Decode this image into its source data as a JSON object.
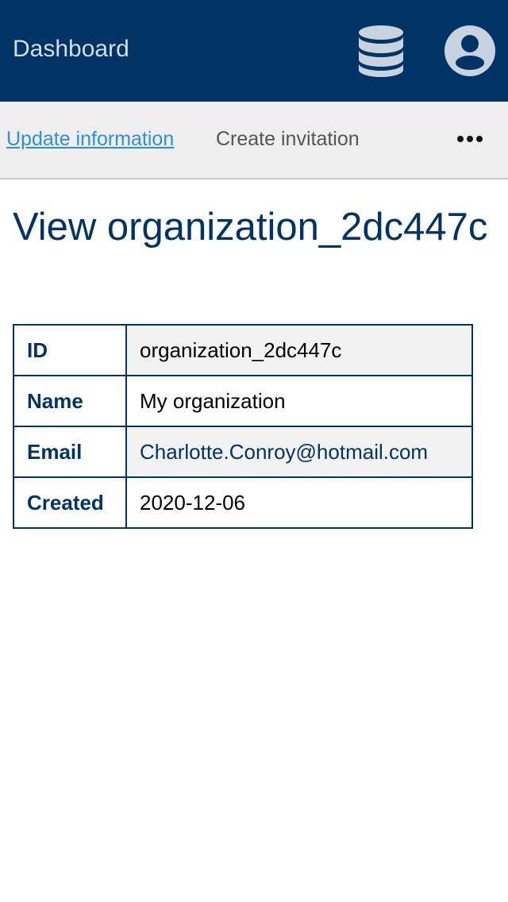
{
  "header": {
    "title": "Dashboard",
    "icons": [
      "database-icon",
      "user-account-icon"
    ],
    "bg_color": "#003366"
  },
  "subnav": {
    "update_label": "Update information",
    "create_label": "Create invitation",
    "more_icon": "more-dots-icon"
  },
  "page": {
    "heading": "View organization_2dc447c"
  },
  "details": {
    "rows": [
      {
        "label": "ID",
        "value": "organization_2dc447c"
      },
      {
        "label": "Name",
        "value": "My organization"
      },
      {
        "label": "Email",
        "value": "Charlotte.Conroy@hotmail.com"
      },
      {
        "label": "Created",
        "value": "2020-12-06"
      }
    ]
  }
}
